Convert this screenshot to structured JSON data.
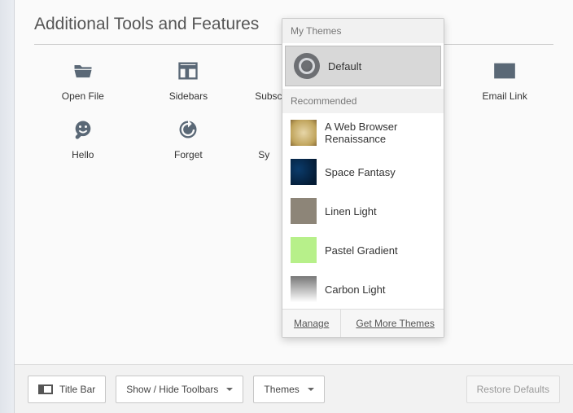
{
  "heading": "Additional Tools and Features",
  "tools": [
    {
      "label": "Open File"
    },
    {
      "label": "Sidebars"
    },
    {
      "label": "Subscribe"
    },
    {
      "label": ""
    },
    {
      "label": "Email Link"
    },
    {
      "label": "Hello"
    },
    {
      "label": "Forget"
    },
    {
      "label": "Sync"
    }
  ],
  "popup": {
    "sections": {
      "mine": "My Themes",
      "recommended": "Recommended"
    },
    "themes": {
      "default": "Default",
      "ren": "A Web Browser Renaissance",
      "space": "Space Fantasy",
      "linen": "Linen Light",
      "pastel": "Pastel Gradient",
      "carbon": "Carbon Light"
    },
    "footer": {
      "manage": "Manage",
      "more": "Get More Themes"
    }
  },
  "bottombar": {
    "titlebar": "Title Bar",
    "showhide": "Show / Hide Toolbars",
    "themes": "Themes",
    "restore": "Restore Defaults"
  }
}
